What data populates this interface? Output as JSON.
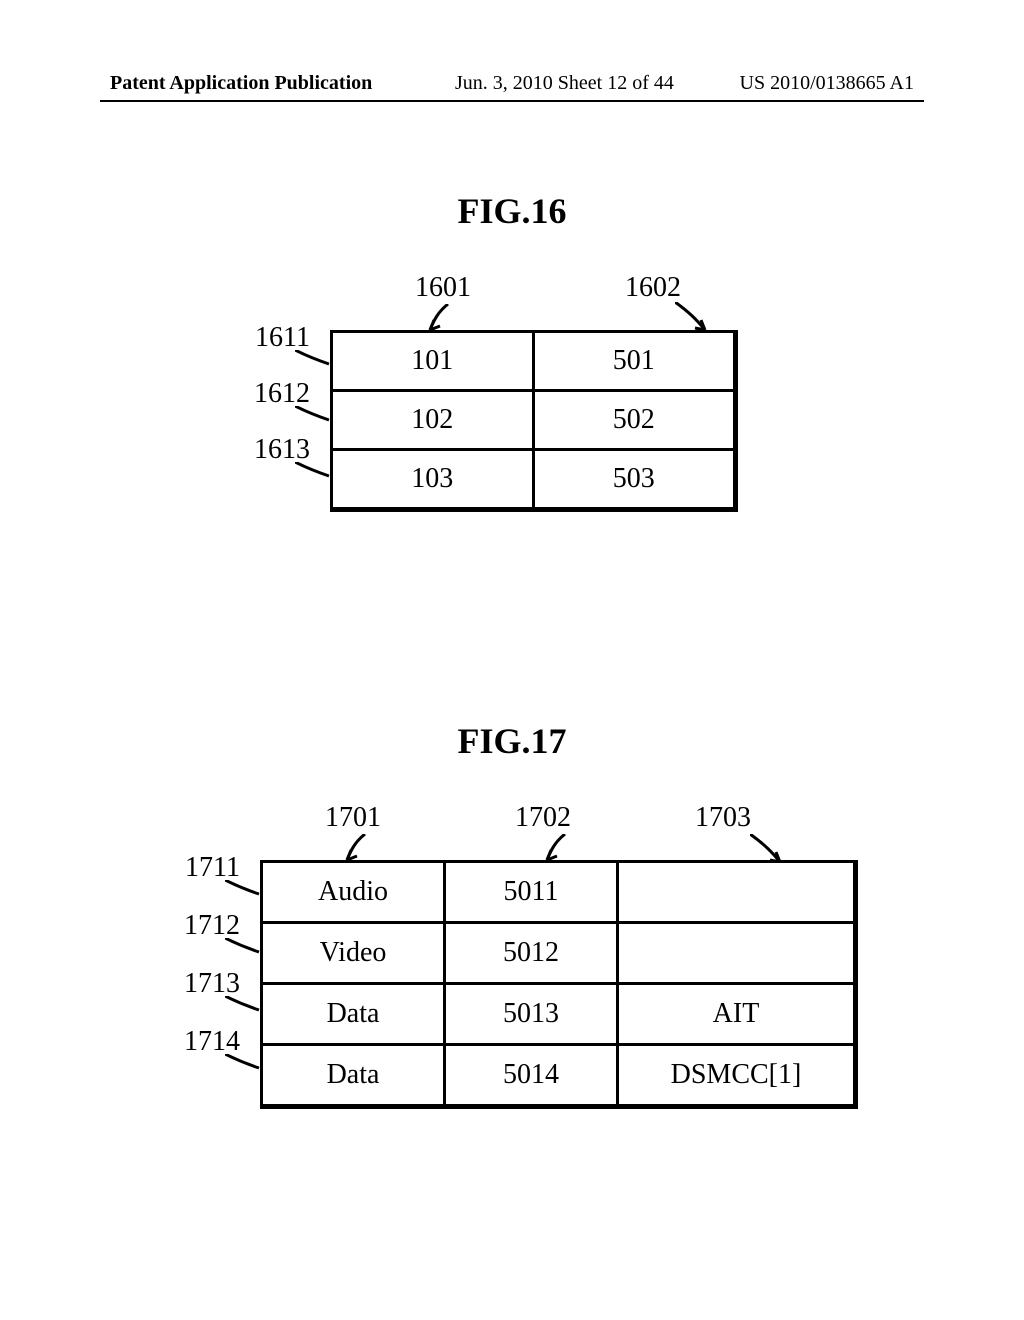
{
  "header": {
    "left": "Patent Application Publication",
    "mid": "Jun. 3, 2010  Sheet 12 of 44",
    "right": "US 2010/0138665 A1"
  },
  "fig16": {
    "title": "FIG.16",
    "col_labels": [
      "1601",
      "1602"
    ],
    "row_labels": [
      "1611",
      "1612",
      "1613"
    ],
    "rows": [
      {
        "c1": "101",
        "c2": "501"
      },
      {
        "c1": "102",
        "c2": "502"
      },
      {
        "c1": "103",
        "c2": "503"
      }
    ]
  },
  "fig17": {
    "title": "FIG.17",
    "col_labels": [
      "1701",
      "1702",
      "1703"
    ],
    "row_labels": [
      "1711",
      "1712",
      "1713",
      "1714"
    ],
    "rows": [
      {
        "c1": "Audio",
        "c2": "5011",
        "c3": ""
      },
      {
        "c1": "Video",
        "c2": "5012",
        "c3": ""
      },
      {
        "c1": "Data",
        "c2": "5013",
        "c3": "AIT"
      },
      {
        "c1": "Data",
        "c2": "5014",
        "c3": "DSMCC[1]"
      }
    ]
  }
}
